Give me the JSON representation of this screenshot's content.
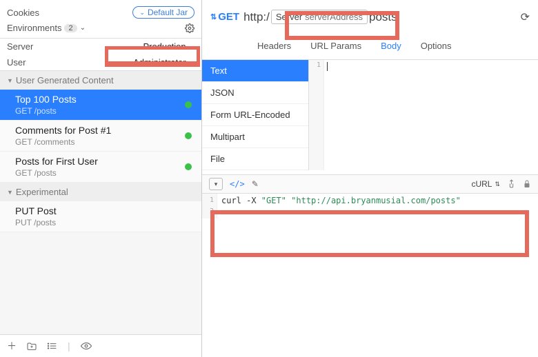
{
  "sidebar": {
    "cookies_label": "Cookies",
    "default_jar_label": "Default Jar",
    "environments_label": "Environments",
    "environments_count": "2",
    "vars": [
      {
        "key": "Server",
        "value": "Production"
      },
      {
        "key": "User",
        "value": "Administrator"
      }
    ],
    "groups": [
      {
        "name": "User Generated Content",
        "items": [
          {
            "name": "Top 100 Posts",
            "sub": "GET /posts",
            "selected": true,
            "dot": true
          },
          {
            "name": "Comments for Post #1",
            "sub": "GET /comments",
            "selected": false,
            "dot": true
          },
          {
            "name": "Posts for First User",
            "sub": "GET /posts",
            "selected": false,
            "dot": true
          }
        ]
      },
      {
        "name": "Experimental",
        "items": [
          {
            "name": "PUT Post",
            "sub": "PUT /posts",
            "selected": false,
            "dot": false
          }
        ]
      }
    ]
  },
  "request": {
    "method": "GET",
    "url_prefix": "http:/",
    "token_key": "Server",
    "token_field": "serverAddress",
    "url_suffix": "posts",
    "tabs": [
      "Headers",
      "URL Params",
      "Body",
      "Options"
    ],
    "active_tab": "Body",
    "body_types": [
      "Text",
      "JSON",
      "Form URL-Encoded",
      "Multipart",
      "File"
    ],
    "body_type_selected": "Text",
    "editor_line": "1"
  },
  "output": {
    "format_label": "cURL",
    "gutter": [
      "1",
      "2"
    ],
    "code": {
      "cmd": "curl -X ",
      "method": "\"GET\"",
      "sep": " ",
      "url": "\"http://api.bryanmusial.com/posts\""
    }
  }
}
